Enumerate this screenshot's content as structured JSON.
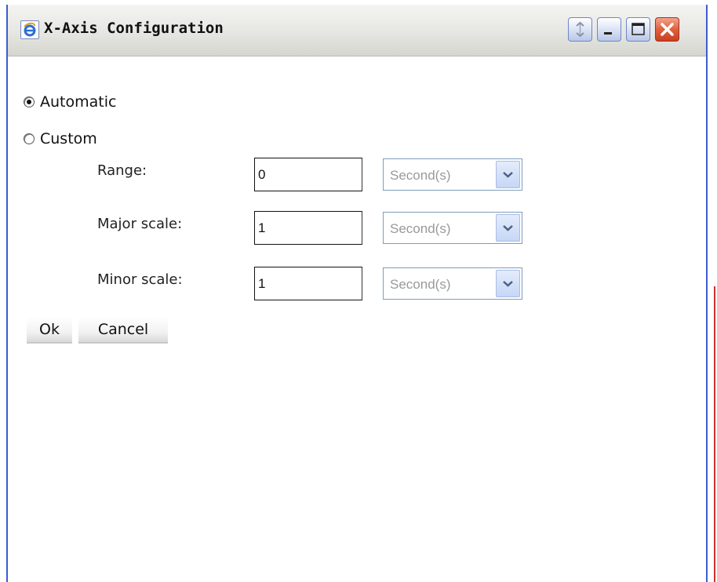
{
  "window": {
    "title": "X-Axis Configuration",
    "icon": "ie-icon",
    "controls": [
      "refresh-icon",
      "minimize-icon",
      "maximize-icon",
      "close-icon"
    ]
  },
  "mode": {
    "automatic_label": "Automatic",
    "custom_label": "Custom",
    "selected": "Automatic"
  },
  "fields": {
    "range": {
      "label": "Range:",
      "value": "0",
      "unit": "Second(s)"
    },
    "major_scale": {
      "label": "Major scale:",
      "value": "1",
      "unit": "Second(s)"
    },
    "minor_scale": {
      "label": "Minor scale:",
      "value": "1",
      "unit": "Second(s)"
    }
  },
  "buttons": {
    "ok": "Ok",
    "cancel": "Cancel"
  },
  "colors": {
    "window_border": "#3d5bd0",
    "close_button": "#e0603e",
    "disabled_text": "#999999"
  }
}
